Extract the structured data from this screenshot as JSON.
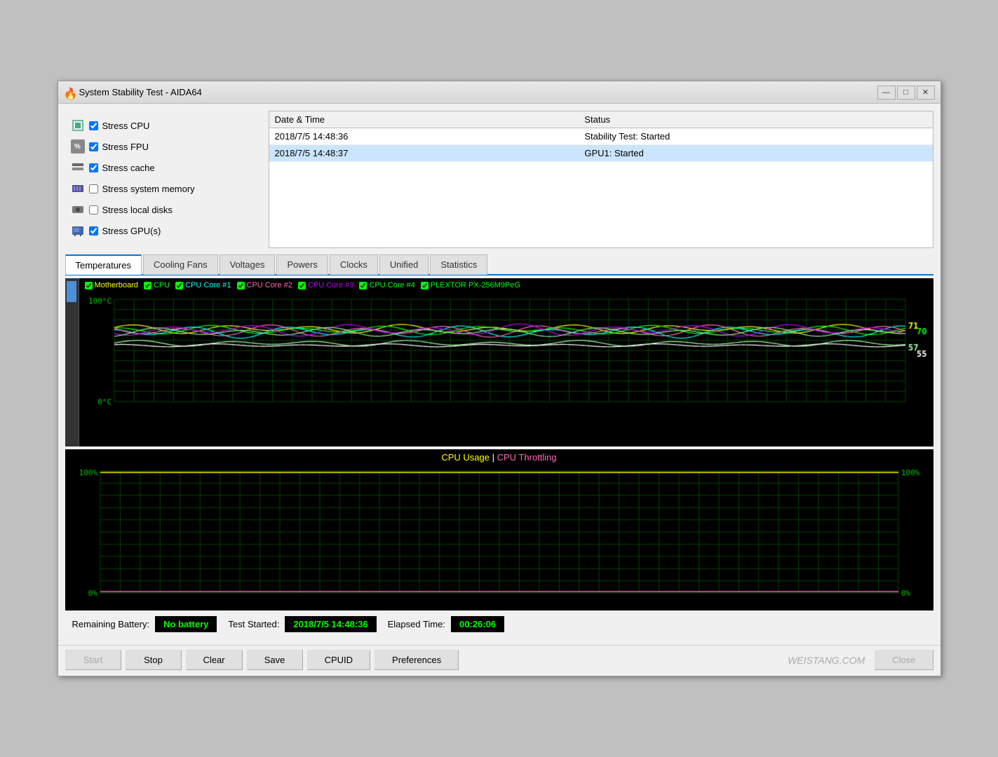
{
  "window": {
    "title": "System Stability Test - AIDA64",
    "icon": "🔥"
  },
  "titlebar": {
    "minimize": "—",
    "maximize": "□",
    "close": "✕"
  },
  "stress_options": [
    {
      "id": "cpu",
      "label": "Stress CPU",
      "checked": true,
      "icon": "🟩"
    },
    {
      "id": "fpu",
      "label": "Stress FPU",
      "checked": true,
      "icon": "%"
    },
    {
      "id": "cache",
      "label": "Stress cache",
      "checked": true,
      "icon": "🟫"
    },
    {
      "id": "memory",
      "label": "Stress system memory",
      "checked": false,
      "icon": "🟦"
    },
    {
      "id": "disks",
      "label": "Stress local disks",
      "checked": false,
      "icon": "💽"
    },
    {
      "id": "gpu",
      "label": "Stress GPU(s)",
      "checked": true,
      "icon": "🖥"
    }
  ],
  "log": {
    "columns": [
      "Date & Time",
      "Status"
    ],
    "rows": [
      {
        "datetime": "2018/7/5 14:48:36",
        "status": "Stability Test: Started",
        "highlighted": false
      },
      {
        "datetime": "2018/7/5 14:48:37",
        "status": "GPU1: Started",
        "highlighted": true
      }
    ]
  },
  "tabs": [
    {
      "id": "temperatures",
      "label": "Temperatures",
      "active": true
    },
    {
      "id": "cooling_fans",
      "label": "Cooling Fans",
      "active": false
    },
    {
      "id": "voltages",
      "label": "Voltages",
      "active": false
    },
    {
      "id": "powers",
      "label": "Powers",
      "active": false
    },
    {
      "id": "clocks",
      "label": "Clocks",
      "active": false
    },
    {
      "id": "unified",
      "label": "Unified",
      "active": false
    },
    {
      "id": "statistics",
      "label": "Statistics",
      "active": false
    }
  ],
  "temp_chart": {
    "legend": [
      {
        "id": "motherboard",
        "label": "Motherboard",
        "color": "#ffff00",
        "checked": true
      },
      {
        "id": "cpu",
        "label": "CPU",
        "color": "#00ff00",
        "checked": true
      },
      {
        "id": "core1",
        "label": "CPU Core #1",
        "color": "#00ffff",
        "checked": true
      },
      {
        "id": "core2",
        "label": "CPU Core #2",
        "color": "#ff69b4",
        "checked": true
      },
      {
        "id": "core3",
        "label": "CPU Core #3",
        "color": "#bf00ff",
        "checked": true
      },
      {
        "id": "core4",
        "label": "CPU Core #4",
        "color": "#90ee90",
        "checked": true
      },
      {
        "id": "plextor",
        "label": "PLEXTOR PX-256M9PeG",
        "color": "#00ff00",
        "checked": true
      }
    ],
    "y_max": 100,
    "y_min": 0,
    "y_max_label": "100°C",
    "y_min_label": "0°C",
    "values": {
      "71": "71",
      "70": "70",
      "57": "57",
      "55": "55"
    }
  },
  "cpu_chart": {
    "title_usage": "CPU Usage",
    "title_separator": "|",
    "title_throttling": "CPU Throttling",
    "y_max_label": "100%",
    "y_min_label": "0%",
    "right_max": "100%",
    "right_min": "0%"
  },
  "status_bar": {
    "battery_label": "Remaining Battery:",
    "battery_value": "No battery",
    "test_started_label": "Test Started:",
    "test_started_value": "2018/7/5 14:48:36",
    "elapsed_label": "Elapsed Time:",
    "elapsed_value": "00:26:06"
  },
  "buttons": {
    "start": "Start",
    "stop": "Stop",
    "clear": "Clear",
    "save": "Save",
    "cpuid": "CPUID",
    "preferences": "Preferences",
    "close": "Close"
  },
  "watermark": "WEISTANG.COM"
}
